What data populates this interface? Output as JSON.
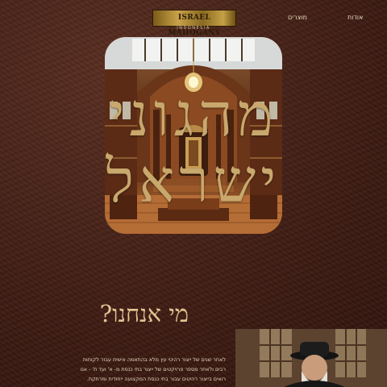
{
  "header": {
    "logo_text": "ISRAEL MAHOGANY",
    "logo_sub": "INDONESIA",
    "nav": [
      {
        "label": "מוצרים"
      },
      {
        "label": "אודות"
      }
    ]
  },
  "hero": {
    "title_line1": "מהגוני",
    "title_line2": "ישראל"
  },
  "about": {
    "heading": "מי אנחנו?",
    "text": "לאחר שנים של ייצור רהיטי עץ מלא בהתאמה אישית עבור לקוחות רבים ולאחר מספר פרויקטים של ייצור בתי כנסת מ- א' ועד ת' - אנו רואים בייצור רהיטים עבור בתי כנסת המקצועה ייחודית ומרתקת."
  },
  "colors": {
    "background": "#3f1d14",
    "gold": "#c8a86c",
    "logo_gold": "#c9a349"
  }
}
